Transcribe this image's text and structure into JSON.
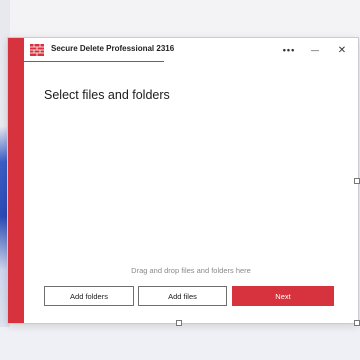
{
  "window": {
    "title": "Secure Delete Professional 2316",
    "icon": "app-brick-icon",
    "more_glyph": "•••",
    "minimize_glyph": "—",
    "close_glyph": "✕"
  },
  "main": {
    "heading": "Select files and folders",
    "drop_hint": "Drag and drop files and folders here"
  },
  "buttons": {
    "add_folders": "Add folders",
    "add_files": "Add files",
    "next": "Next"
  },
  "colors": {
    "accent": "#d7333e"
  }
}
